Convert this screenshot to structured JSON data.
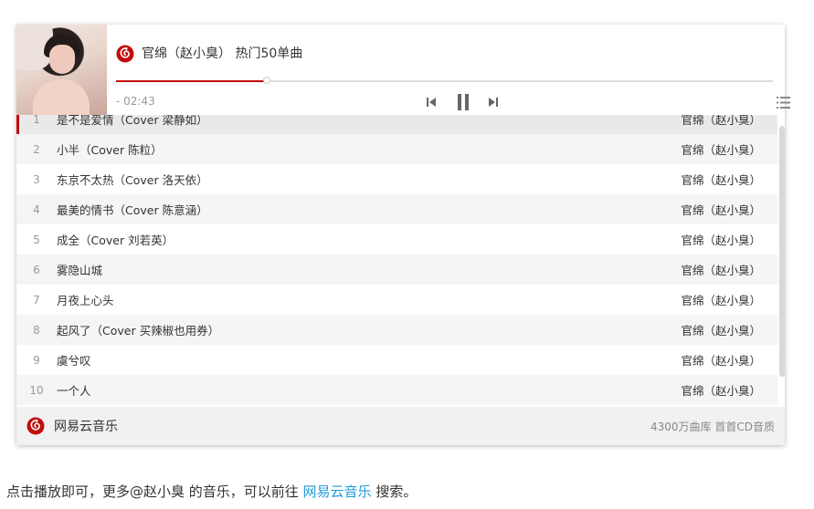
{
  "player": {
    "title": "官绵（赵小臭） 热门50单曲",
    "time": "- 02:43",
    "progress_fraction": 0.23
  },
  "playlist": [
    {
      "index": "1",
      "name": "是不是爱情（Cover 梁静如）",
      "artist": "官绵（赵小臭）",
      "active": true
    },
    {
      "index": "2",
      "name": "小半（Cover 陈粒）",
      "artist": "官绵（赵小臭）"
    },
    {
      "index": "3",
      "name": "东京不太热（Cover 洛天依）",
      "artist": "官绵（赵小臭）"
    },
    {
      "index": "4",
      "name": "最美的情书（Cover 陈意涵）",
      "artist": "官绵（赵小臭）"
    },
    {
      "index": "5",
      "name": "成全（Cover 刘若英）",
      "artist": "官绵（赵小臭）"
    },
    {
      "index": "6",
      "name": "雾隐山城",
      "artist": "官绵（赵小臭）"
    },
    {
      "index": "7",
      "name": "月夜上心头",
      "artist": "官绵（赵小臭）"
    },
    {
      "index": "8",
      "name": "起风了（Cover 买辣椒也用券）",
      "artist": "官绵（赵小臭）"
    },
    {
      "index": "9",
      "name": "虞兮叹",
      "artist": "官绵（赵小臭）"
    },
    {
      "index": "10",
      "name": "一个人",
      "artist": "官绵（赵小臭）"
    }
  ],
  "footer": {
    "brand": "网易云音乐",
    "tagline": "4300万曲库 首首CD音质"
  },
  "note": {
    "prefix": "点击播放即可，更多@赵小臭 的音乐，可以前往 ",
    "link": "网易云音乐",
    "suffix": " 搜索。"
  },
  "icons": {
    "logo": "netease-cloud-music-icon",
    "prev": "skip-previous-icon",
    "pause": "pause-icon",
    "next": "skip-next-icon",
    "menu": "playlist-menu-icon"
  },
  "colors": {
    "accent": "#c20c0c",
    "link": "#1e9ad9"
  }
}
